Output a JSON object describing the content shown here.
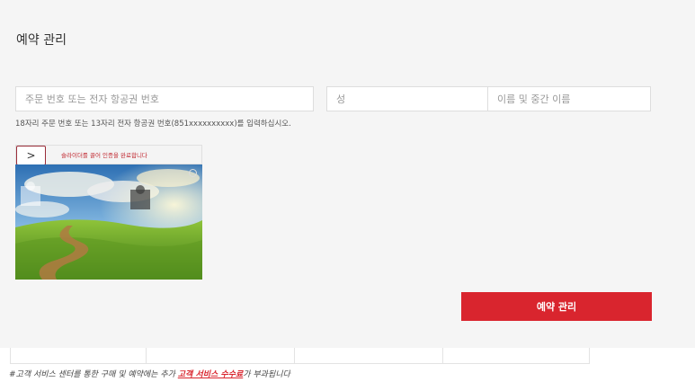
{
  "page": {
    "title": "예약 관리"
  },
  "form": {
    "order_placeholder": "주문 번호 또는 전자 항공권 번호",
    "lastname_placeholder": "성",
    "firstname_placeholder": "이름 및 중간 이름",
    "hint": "18자리 주문 번호 또는 13자리 전자 항공권 번호(851xxxxxxxxxx)를 입력하십시오.",
    "submit_label": "예약 관리"
  },
  "captcha": {
    "handle_icon": "chevron-right-icon",
    "handle_glyph": ">",
    "instruction": "슬라이더를 끌어 인증을 완료합니다"
  },
  "footnote": {
    "prefix": "#고객 서비스 센터를 통한 구매 및 예약에는 추가 ",
    "link": "고객 서비스 수수료",
    "suffix": "가 부과됩니다"
  },
  "colors": {
    "accent": "#d9252e",
    "panel_bg": "#f5f5f5"
  }
}
